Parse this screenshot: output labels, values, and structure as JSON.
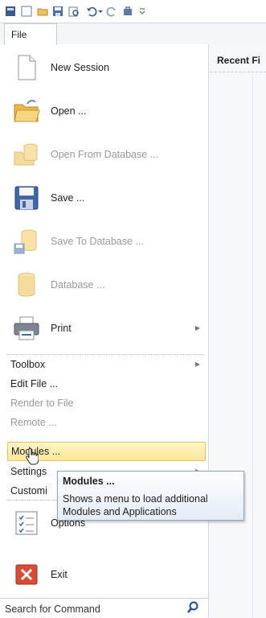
{
  "quick_access": {
    "icons": [
      "app-icon",
      "window-icon",
      "open-folder-icon",
      "save-icon",
      "print-preview-icon",
      "undo-icon",
      "undo-dropdown-icon",
      "redo-icon",
      "toolbox-icon",
      "customize-qat-icon"
    ]
  },
  "file_tab": {
    "label": "File"
  },
  "right_pane": {
    "heading": "Recent Fi"
  },
  "menu": {
    "new_session": "New Session",
    "open": "Open ...",
    "open_db": "Open From Database ...",
    "save": "Save ...",
    "save_db": "Save To Database ...",
    "database": "Database ...",
    "print": "Print",
    "toolbox": "Toolbox",
    "edit_file": "Edit File ...",
    "render_to_file": "Render to File",
    "remote": "Remote ...",
    "modules": "Modules ...",
    "settings": "Settings",
    "customize": "Customi",
    "options": "Options",
    "exit": "Exit"
  },
  "tooltip": {
    "title": "Modules ...",
    "body": "Shows a menu to load additional Modules and Applications"
  },
  "search": {
    "placeholder": "Search for Command"
  },
  "colors": {
    "hover_bg": "#ffe79a",
    "disabled_text": "#9a9a9a",
    "tooltip_border": "#8fa6c2"
  }
}
